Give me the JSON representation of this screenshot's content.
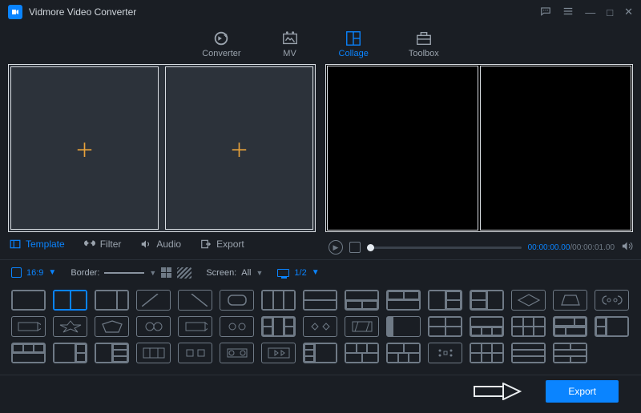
{
  "app": {
    "title": "Vidmore Video Converter"
  },
  "nav": {
    "converter": "Converter",
    "mv": "MV",
    "collage": "Collage",
    "toolbox": "Toolbox",
    "active": "collage"
  },
  "subtabs": {
    "template": "Template",
    "filter": "Filter",
    "audio": "Audio",
    "export": "Export",
    "active": "template"
  },
  "player": {
    "current_time": "00:00:00.00",
    "total_time": "00:00:01.00",
    "sep": "/"
  },
  "options": {
    "aspect_label": "16:9",
    "border_label": "Border:",
    "screen_label": "Screen:",
    "screen_value": "All",
    "pages": "1/2"
  },
  "bottom": {
    "export_label": "Export"
  }
}
